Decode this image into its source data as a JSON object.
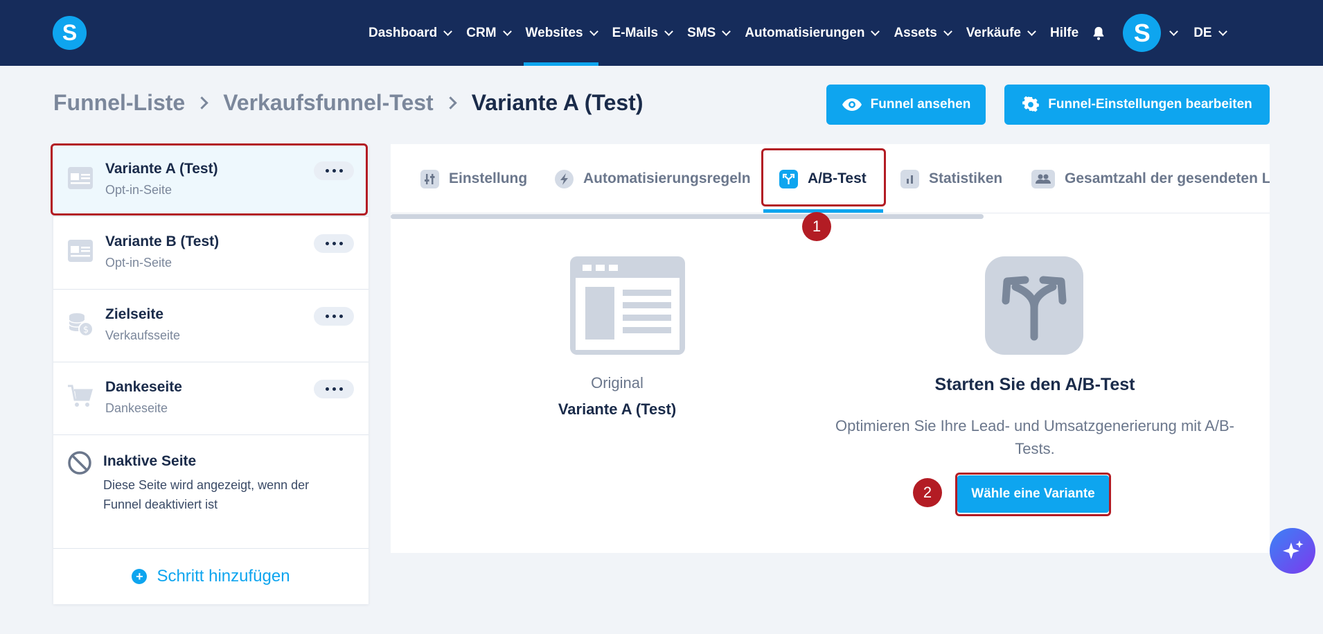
{
  "nav": {
    "logo": "S",
    "items": [
      {
        "label": "Dashboard",
        "has_dropdown": true
      },
      {
        "label": "CRM",
        "has_dropdown": true
      },
      {
        "label": "Websites",
        "has_dropdown": true,
        "active": true
      },
      {
        "label": "E-Mails",
        "has_dropdown": true
      },
      {
        "label": "SMS",
        "has_dropdown": true
      },
      {
        "label": "Automatisierungen",
        "has_dropdown": true
      },
      {
        "label": "Assets",
        "has_dropdown": true
      },
      {
        "label": "Verkäufe",
        "has_dropdown": true
      },
      {
        "label": "Hilfe",
        "has_dropdown": false
      }
    ],
    "bell_icon": "bell-icon",
    "avatar": "S",
    "language": "DE"
  },
  "breadcrumb": {
    "items": [
      "Funnel-Liste",
      "Verkaufsfunnel-Test",
      "Variante A (Test)"
    ]
  },
  "actions": {
    "view_funnel": "Funnel ansehen",
    "edit_settings": "Funnel-Einstellungen bearbeiten"
  },
  "steps": [
    {
      "title": "Variante A (Test)",
      "subtitle": "Opt-in-Seite",
      "icon": "page-layout-icon",
      "selected": true
    },
    {
      "title": "Variante B (Test)",
      "subtitle": "Opt-in-Seite",
      "icon": "page-layout-icon"
    },
    {
      "title": "Zielseite",
      "subtitle": "Verkaufsseite",
      "icon": "coins-icon"
    },
    {
      "title": "Dankeseite",
      "subtitle": "Dankeseite",
      "icon": "cart-icon"
    }
  ],
  "inactive_page": {
    "title": "Inaktive Seite",
    "description": "Diese Seite wird angezeigt, wenn der Funnel deaktiviert ist"
  },
  "add_step": "Schritt hinzufügen",
  "tabs": [
    {
      "label": "Einstellung",
      "icon": "sliders-icon"
    },
    {
      "label": "Automatisierungsregeln",
      "icon": "bolt-icon"
    },
    {
      "label": "A/B-Test",
      "icon": "split-icon",
      "active": true
    },
    {
      "label": "Statistiken",
      "icon": "bar-chart-icon"
    },
    {
      "label": "Gesamtzahl der gesendeten L",
      "icon": "users-icon"
    }
  ],
  "original": {
    "label": "Original",
    "name": "Variante A (Test)"
  },
  "ab_test": {
    "title": "Starten Sie den A/B-Test",
    "description": "Optimieren Sie Ihre Lead- und Umsatzgenerierung mit A/B-Tests.",
    "button": "Wähle eine Variante"
  },
  "annotations": [
    "1",
    "2"
  ],
  "colors": {
    "nav_bg": "#162c5b",
    "accent": "#0ea5ef",
    "highlight": "#b31c24"
  }
}
